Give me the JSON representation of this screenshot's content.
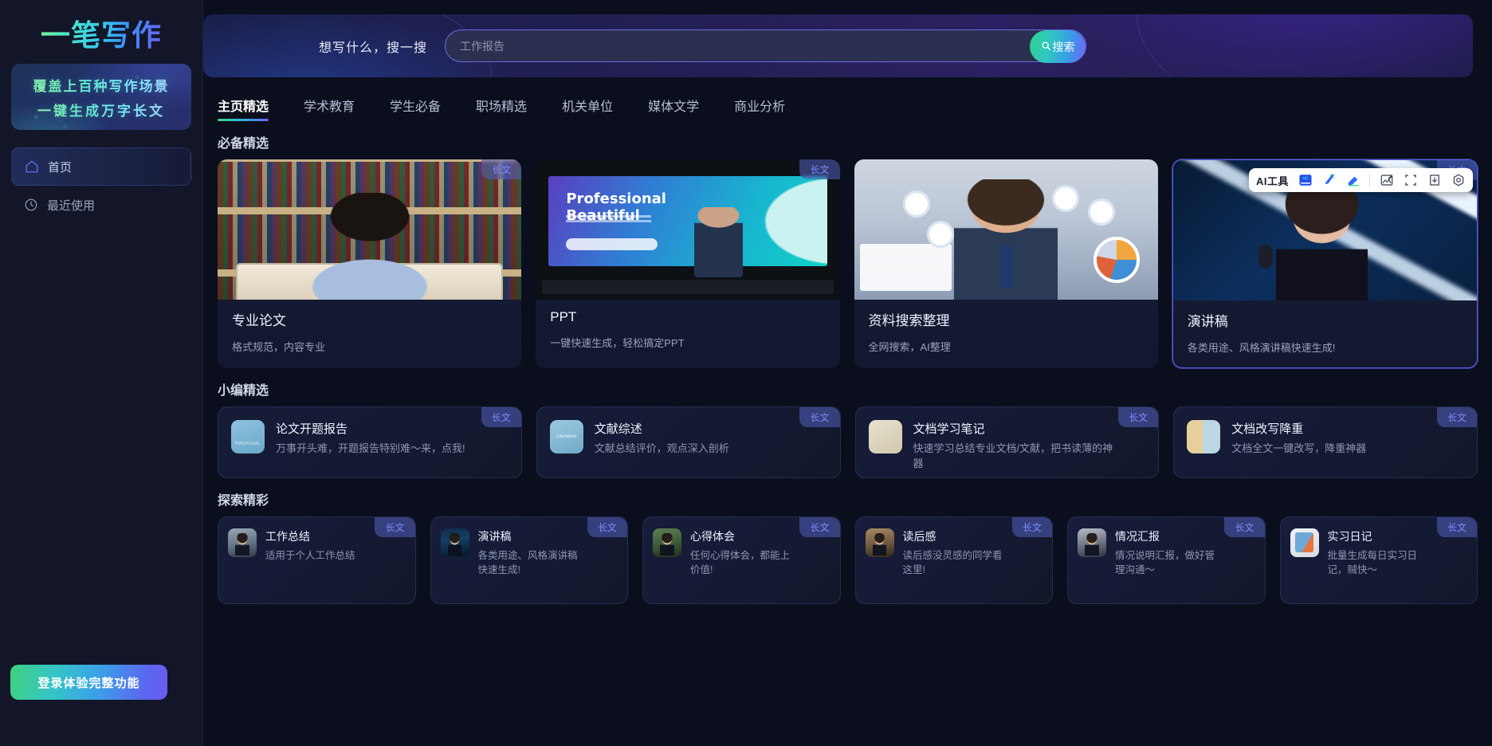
{
  "brand": {
    "logo": "一笔写作"
  },
  "sidebar": {
    "promo_line1": "覆盖上百种写作场景",
    "promo_line2": "一键生成万字长文",
    "nav": [
      {
        "label": "首页",
        "icon": "home-icon",
        "active": true
      },
      {
        "label": "最近使用",
        "icon": "clock-icon",
        "active": false
      }
    ],
    "login_button": "登录体验完整功能"
  },
  "hero": {
    "prompt_label": "想写什么，搜一搜",
    "search_value": "",
    "search_placeholder": "工作报告",
    "search_button": "搜索",
    "search_icon": "search-icon"
  },
  "tabs": [
    {
      "label": "主页精选",
      "active": true
    },
    {
      "label": "学术教育",
      "active": false
    },
    {
      "label": "学生必备",
      "active": false
    },
    {
      "label": "职场精选",
      "active": false
    },
    {
      "label": "机关单位",
      "active": false
    },
    {
      "label": "媒体文学",
      "active": false
    },
    {
      "label": "商业分析",
      "active": false
    }
  ],
  "toolbar": {
    "ai_label": "AI工具",
    "items": [
      {
        "name": "hd-icon",
        "label": "HD"
      },
      {
        "name": "magic-wand-icon",
        "label": ""
      },
      {
        "name": "eraser-icon",
        "label": ""
      },
      {
        "name": "image-edit-icon",
        "label": ""
      },
      {
        "name": "crop-icon",
        "label": ""
      },
      {
        "name": "download-icon",
        "label": ""
      },
      {
        "name": "settings-icon",
        "label": ""
      }
    ]
  },
  "sections": [
    {
      "title": "必备精选",
      "type": "featured",
      "cards": [
        {
          "title": "专业论文",
          "desc": "格式规范，内容专业",
          "badge": "长文",
          "art": "library",
          "selected": false
        },
        {
          "title": "PPT",
          "desc": "一键快速生成，轻松搞定PPT",
          "badge": "长文",
          "art": "ppt",
          "selected": false
        },
        {
          "title": "资料搜索整理",
          "desc": "全网搜索，AI整理",
          "badge": "",
          "art": "analyst",
          "selected": false
        },
        {
          "title": "演讲稿",
          "desc": "各类用途、风格演讲稿快速生成!",
          "badge": "长文",
          "art": "speaker",
          "selected": true
        }
      ],
      "ppt_art": {
        "title_line1": "Professional",
        "title_line2": "Beautiful"
      }
    },
    {
      "title": "小编精选",
      "type": "mid",
      "cards": [
        {
          "title": "论文开题报告",
          "desc": "万事开头难，开题报告特别难～来，点我!",
          "badge": "长文",
          "icon": "sq-proposal",
          "icon_text": "PROPOSAL"
        },
        {
          "title": "文献综述",
          "desc": "文献总结评价，观点深入剖析",
          "badge": "长文",
          "icon": "sq-literature",
          "icon_text": "Literature"
        },
        {
          "title": "文档学习笔记",
          "desc": "快速学习总结专业文档/文献，把书读薄的神器",
          "badge": "长文",
          "icon": "sq-notes",
          "icon_text": ""
        },
        {
          "title": "文档改写降重",
          "desc": "文档全文一键改写，降重神器",
          "badge": "长文",
          "icon": "sq-rewrite",
          "icon_text": ""
        }
      ]
    },
    {
      "title": "探索精彩",
      "type": "small",
      "cards": [
        {
          "title": "工作总结",
          "desc": "适用于个人工作总结",
          "badge": "长文",
          "icon": "sq-work"
        },
        {
          "title": "演讲稿",
          "desc": "各类用途、风格演讲稿快速生成!",
          "badge": "长文",
          "icon": "sq-speech"
        },
        {
          "title": "心得体会",
          "desc": "任何心得体会，都能上价值!",
          "badge": "长文",
          "icon": "sq-insight"
        },
        {
          "title": "读后感",
          "desc": "读后感没灵感的同学看这里!",
          "badge": "长文",
          "icon": "sq-read"
        },
        {
          "title": "情况汇报",
          "desc": "情况说明汇报，做好管理沟通～",
          "badge": "长文",
          "icon": "sq-report"
        },
        {
          "title": "实习日记",
          "desc": "批量生成每日实习日记，贼快～",
          "badge": "长文",
          "icon": "sq-diary"
        }
      ]
    }
  ],
  "colors": {
    "accent_gradient_start": "#3fd17f",
    "accent_gradient_end": "#6a5bf2",
    "badge_text": "#7b8cff",
    "selected_border": "#5b62e6",
    "page_bg": "#0b0f1d",
    "sidebar_bg": "#121628"
  }
}
